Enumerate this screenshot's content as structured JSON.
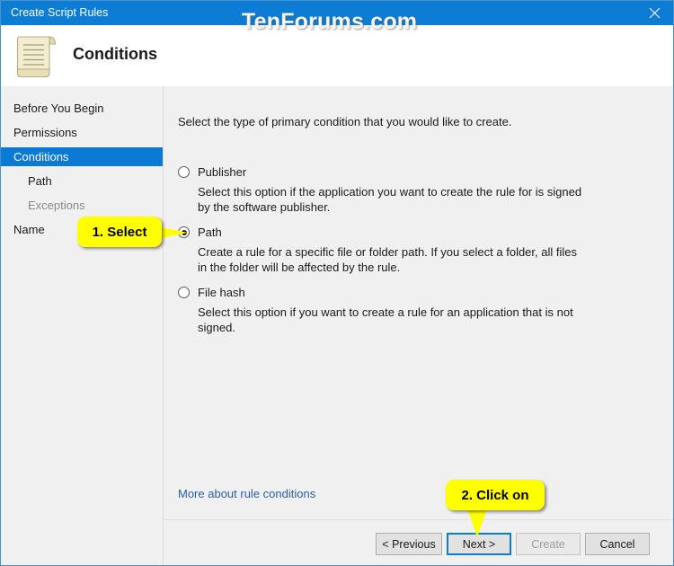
{
  "window": {
    "title": "Create Script Rules",
    "close_icon": "close-icon"
  },
  "watermark": {
    "text": "TenForums.com"
  },
  "header": {
    "icon": "scroll-document-icon",
    "title": "Conditions"
  },
  "sidebar": {
    "items": [
      {
        "label": "Before You Begin",
        "state": "normal",
        "indent": false
      },
      {
        "label": "Permissions",
        "state": "normal",
        "indent": false
      },
      {
        "label": "Conditions",
        "state": "selected",
        "indent": false
      },
      {
        "label": "Path",
        "state": "normal",
        "indent": true
      },
      {
        "label": "Exceptions",
        "state": "disabled",
        "indent": true
      },
      {
        "label": "Name",
        "state": "normal",
        "indent": false
      }
    ]
  },
  "main": {
    "intro": "Select the type of primary condition that you would like to create.",
    "options": [
      {
        "label": "Publisher",
        "description": "Select this option if the application you want to create the rule for is signed by the software publisher.",
        "selected": false
      },
      {
        "label": "Path",
        "description": "Create a rule for a specific file or folder path. If you select a folder, all files in the folder will be affected by the rule.",
        "selected": true
      },
      {
        "label": "File hash",
        "description": "Select this option if you want to create a rule for an application that is not signed.",
        "selected": false
      }
    ],
    "help_link": "More about rule conditions"
  },
  "footer": {
    "buttons": [
      {
        "label": "< Previous",
        "state": "normal"
      },
      {
        "label": "Next >",
        "state": "focused"
      },
      {
        "label": "Create",
        "state": "disabled"
      },
      {
        "label": "Cancel",
        "state": "normal"
      }
    ]
  },
  "callouts": [
    {
      "text": "1. Select"
    },
    {
      "text": "2. Click on"
    }
  ],
  "colors": {
    "titlebar": "#0c7cd5",
    "selection": "#0b7ad4",
    "callout": "#ffff00",
    "link": "#2a5faa",
    "focus_border": "#0c7cd5"
  }
}
